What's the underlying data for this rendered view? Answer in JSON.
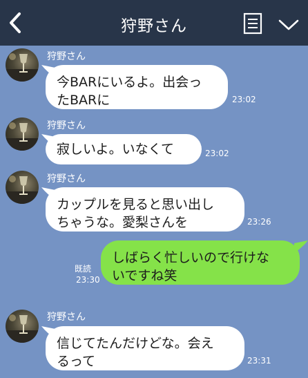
{
  "header": {
    "title": "狩野さん"
  },
  "messages": [
    {
      "sender": "狩野さん",
      "text": "今BARにいるよ。出会っ\nたBARに",
      "time": "23:02"
    },
    {
      "sender": "狩野さん",
      "text": "寂しいよ。いなくて",
      "time": "23:02"
    },
    {
      "sender": "狩野さん",
      "text": "カップルを見ると思い出し\nちゃうな。愛梨さんを",
      "time": "23:26"
    },
    {
      "sender": "me",
      "text": "しばらく忙しいので行けな\nいですね笑",
      "time": "23:30",
      "read": "既読"
    },
    {
      "sender": "狩野さん",
      "text": "信じてたんだけどな。会え\nるって",
      "time": "23:31"
    }
  ],
  "colors": {
    "background": "#7593c4",
    "header": "#283549",
    "incoming_bubble": "#ffffff",
    "outgoing_bubble": "#85e249"
  },
  "icons": {
    "back": "chevron-left-icon",
    "notes": "notes-icon",
    "menu": "chevron-down-icon"
  }
}
